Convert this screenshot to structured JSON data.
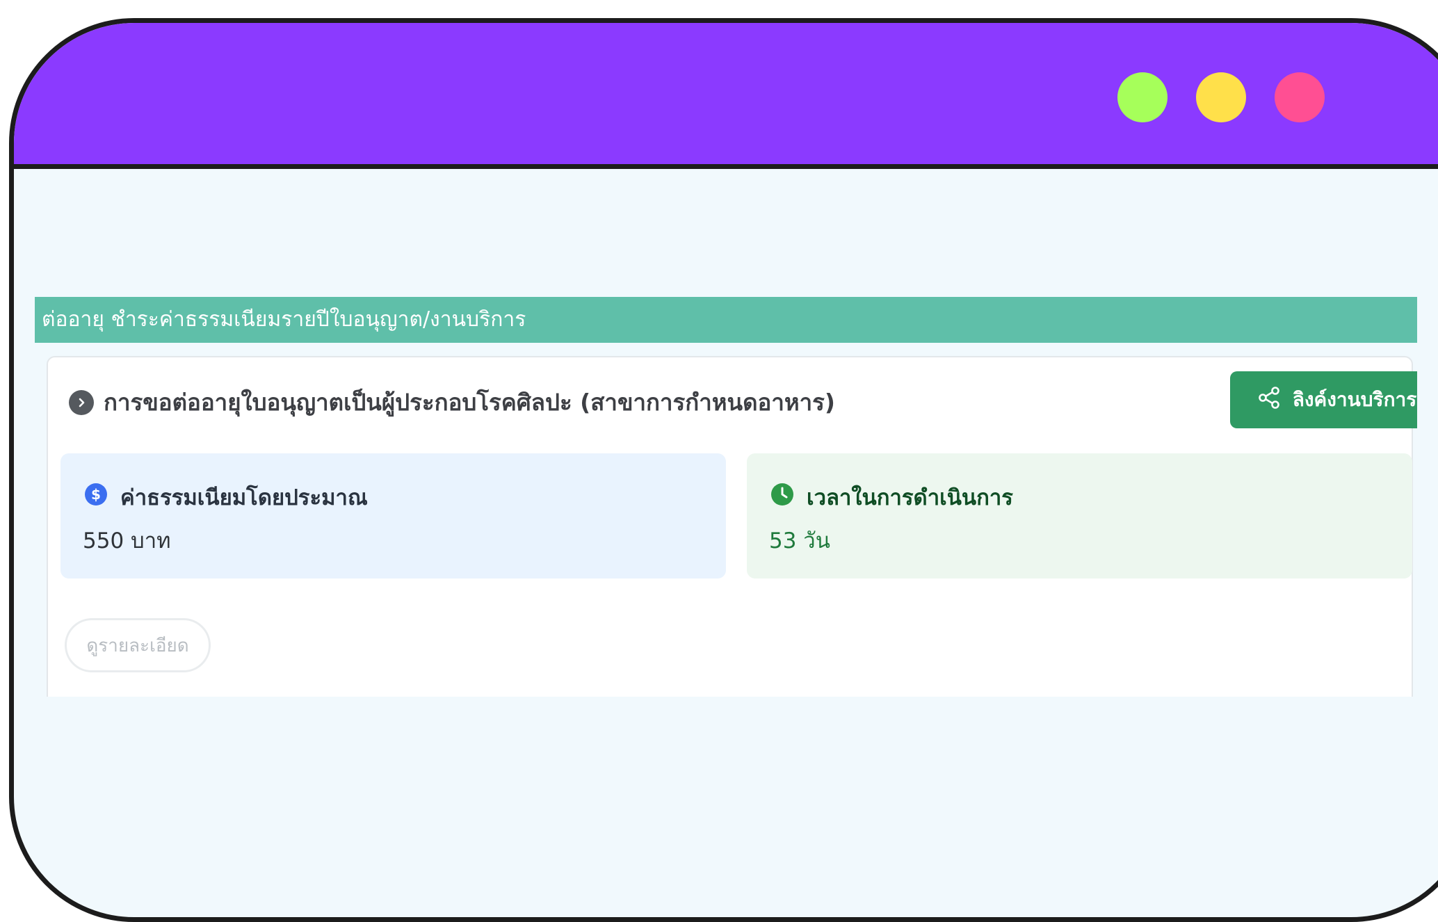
{
  "window": {
    "dots": [
      {
        "name": "green",
        "color": "#a6ff5a"
      },
      {
        "name": "yellow",
        "color": "#ffe04a"
      },
      {
        "name": "pink",
        "color": "#ff4f93"
      }
    ]
  },
  "section": {
    "title": "ต่ออายุ ชำระค่าธรรมเนียมรายปีใบอนุญาต/งานบริการ"
  },
  "card": {
    "title": "การขอต่ออายุใบอนุญาตเป็นผู้ประกอบโรคศิลปะ (สาขาการกำหนดอาหาร)",
    "share_button": "ลิงค์งานบริการ",
    "fee": {
      "label": "ค่าธรรมเนียมโดยประมาณ",
      "value": "550 บาท"
    },
    "time": {
      "label": "เวลาในการดำเนินการ",
      "value": "53 วัน"
    },
    "detail_button": "ดูรายละเอียด"
  },
  "colors": {
    "titlebar": "#8b3aff",
    "section_bar": "#5fbfa9",
    "share_button": "#2f9a63",
    "fee_icon": "#3b6ef0",
    "time_icon": "#2e9a48"
  }
}
